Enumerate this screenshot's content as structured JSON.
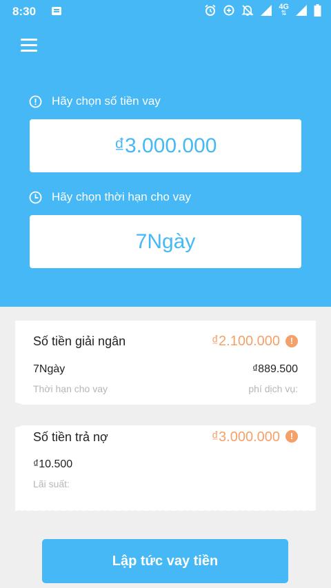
{
  "status_bar": {
    "time": "8:30",
    "network": "4G",
    "icons": [
      "message-icon",
      "alarm-icon",
      "data-saver-icon",
      "notifications-off-icon",
      "signal-icon",
      "network-4g-icon",
      "signal-icon",
      "battery-icon"
    ]
  },
  "colors": {
    "primary": "#45b8f5",
    "accent": "#f5a068",
    "background": "#efefef",
    "muted_text": "#b6b6b6"
  },
  "loan_amount": {
    "label": "Hãy chọn số tiền vay",
    "icon": "alert-circle-icon",
    "value": "₫3.000.000"
  },
  "loan_term": {
    "label": "Hãy chọn thời hạn cho vay",
    "icon": "clock-icon",
    "value": "7Ngày"
  },
  "disbursement": {
    "title": "Số tiền giải ngân",
    "amount": "₫2.100.000",
    "term_value": "7Ngày",
    "term_label": "Thời hạn cho vay",
    "fee_value": "₫889.500",
    "fee_label": "phí dịch vụ:"
  },
  "repayment": {
    "title": "Số tiền trả nợ",
    "amount": "₫3.000.000",
    "interest_value": "₫10.500",
    "interest_label": "Lãi suất:"
  },
  "cta": {
    "label": "Lập tức vay tiền"
  }
}
